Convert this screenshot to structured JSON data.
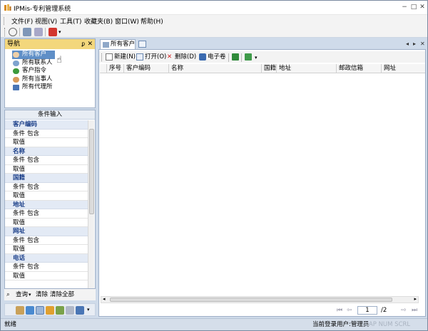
{
  "window": {
    "title": "IPMis-专利管理系统"
  },
  "window_buttons": {
    "minimize": "−",
    "maximize": "□",
    "close": "✕"
  },
  "menu": [
    "文件(F)",
    "视图(V)",
    "工具(T)",
    "收藏夹(B)",
    "窗口(W)",
    "帮助(H)"
  ],
  "nav": {
    "title": "导航",
    "pin": "ᵱ",
    "close": "✕",
    "items": [
      "所有客户",
      "所有联系人",
      "客户指令",
      "所有当事人",
      "所有代理所"
    ]
  },
  "conditions": {
    "title": "条件输入",
    "cond_label": "条件",
    "value_label": "取值",
    "contains": "包含",
    "groups": [
      "客户编码",
      "名称",
      "国籍",
      "地址",
      "网址",
      "电话"
    ]
  },
  "query_bar": {
    "query": "查询",
    "clear": "清除",
    "clear_all": "清除全部"
  },
  "tab": {
    "label": "所有客户"
  },
  "doc_toolbar": {
    "new": "新建(N)",
    "open": "打开(O)",
    "delete": "删除(D)",
    "ecard": "电子卷"
  },
  "grid": {
    "columns": [
      "序号",
      "客户编码",
      "名称",
      "国籍",
      "地址",
      "邮政信箱",
      "网址"
    ]
  },
  "pager": {
    "page": "1",
    "total": "/2"
  },
  "status": {
    "left": "就绪",
    "user": "当前登录用户:管理员",
    "keys": "CAP  NUM  SCRL"
  },
  "colors": {
    "nav_header": "#f3d77c",
    "selected": "#5f8fc7",
    "group_title": "#1a3e88"
  }
}
